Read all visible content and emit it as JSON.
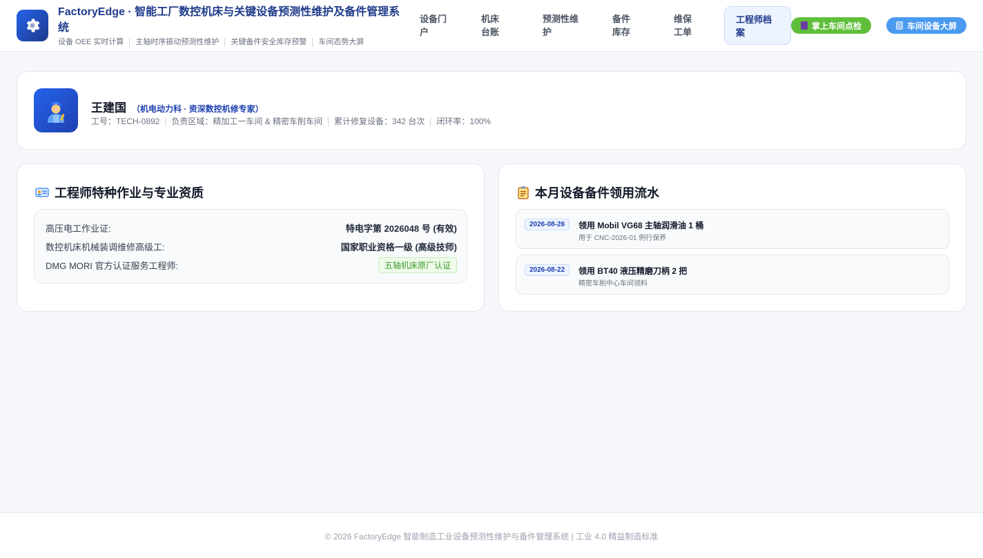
{
  "header": {
    "brand_title": "FactoryEdge · 智能工厂数控机床与关键设备预测性维护及备件管理系统",
    "brand_tags": [
      "设备 OEE 实时计算",
      "主轴时序振动预测性维护",
      "关键备件安全库存预警",
      "车间态势大屏"
    ],
    "nav": [
      {
        "label": "设备门户"
      },
      {
        "label": "机床台账"
      },
      {
        "label": "预测性维护"
      },
      {
        "label": "备件库存"
      },
      {
        "label": "维保工单"
      },
      {
        "label": "工程师档案"
      }
    ],
    "btn_mobile": "掌上车间点检",
    "btn_screen": "车间设备大屏",
    "accent": "#1e3a8a"
  },
  "profile": {
    "name": "王建国",
    "title": "（机电动力科 · 资深数控机修专家）",
    "meta": [
      "工号：TECH-0892",
      "负责区域：精加工一车间 & 精密车削车间",
      "累计修复设备：342 台次",
      "闭环率：100%"
    ]
  },
  "qualifications": {
    "title": "工程师特种作业与专业资质",
    "items": [
      {
        "label": "高压电工作业证:",
        "value": "特电字第 2026048 号 (有效)"
      },
      {
        "label": "数控机床机械装调维修高级工:",
        "value": "国家职业资格一级 (高级技师)"
      },
      {
        "label": "DMG MORI 官方认证服务工程师:",
        "value": "五轴机床原厂认证"
      }
    ]
  },
  "parts_log": {
    "title": "本月设备备件领用流水",
    "items": [
      {
        "date": "2026-08-26",
        "title": "领用 Mobil VG68 主轴润滑油 1 桶",
        "desc": "用于 CNC-2026-01 例行保养"
      },
      {
        "date": "2026-08-22",
        "title": "领用 BT40 液压精磨刀柄 2 把",
        "desc": "精密车削中心车间领料"
      }
    ]
  },
  "footer": {
    "text": "© 2026 FactoryEdge 智能制造工业设备预测性维护与备件管理系统 | 工业 4.0 精益制造标准"
  }
}
